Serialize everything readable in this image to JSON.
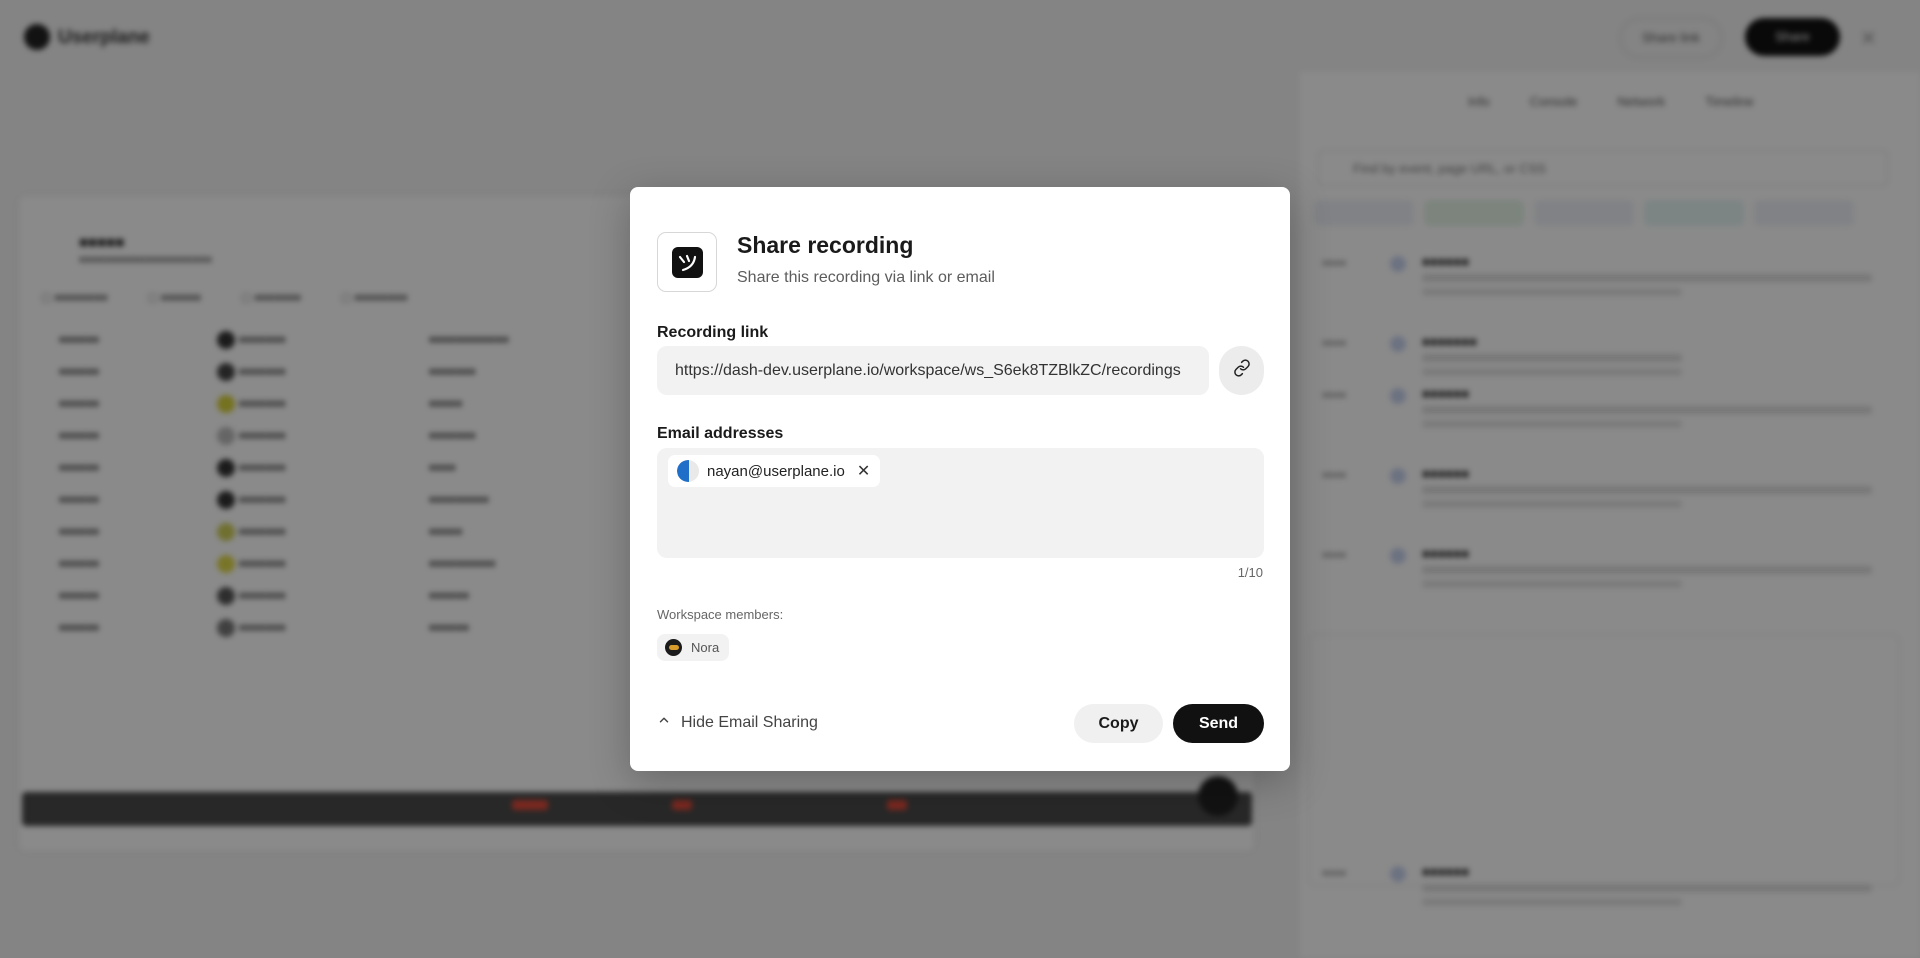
{
  "background": {
    "app_name": "Userplane",
    "top_buttons": [
      "Share link",
      "Share"
    ],
    "panel_tabs": [
      "Info",
      "Console",
      "Network",
      "Timeline"
    ],
    "search_placeholder": "Find by event, page URL, or CSS"
  },
  "modal": {
    "title": "Share recording",
    "subtitle": "Share this recording via link or email",
    "recording_link_label": "Recording link",
    "recording_link_value": "https://dash-dev.userplane.io/workspace/ws_S6ek8TZBlkZC/recordings",
    "email_label": "Email addresses",
    "email_chips": [
      "nayan@userplane.io"
    ],
    "email_counter": "1/10",
    "members_label": "Workspace members:",
    "members": [
      "Nora"
    ],
    "hide_sharing_label": "Hide Email Sharing",
    "copy_label": "Copy",
    "send_label": "Send"
  },
  "icons": {
    "app_icon": "userplane-logo-icon",
    "link_icon": "link-icon",
    "remove_icon": "close-icon",
    "chevron": "chevron-up-icon"
  },
  "colors": {
    "primary_button": "#111111",
    "secondary_button": "#f0f0f0",
    "field_background": "#f2f2f2",
    "avatar_blue": "#1f6fc9"
  }
}
